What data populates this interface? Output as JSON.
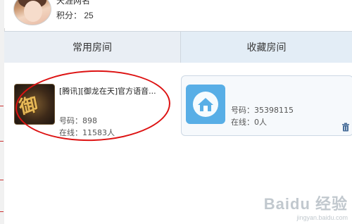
{
  "profile": {
    "username": "天涯网名",
    "points_label": "积分：",
    "points_value": "25"
  },
  "tabs": [
    {
      "label": "常用房间"
    },
    {
      "label": "收藏房间"
    }
  ],
  "rooms": [
    {
      "title": "[腾讯][御龙在天]官方语音...",
      "id_label": "号码：",
      "id_value": "898",
      "online_label": "在线：",
      "online_value": "11583人",
      "icon": "game-icon"
    },
    {
      "title": "",
      "id_label": "号码：",
      "id_value": "35398115",
      "online_label": "在线：",
      "online_value": "0人",
      "icon": "home-icon"
    }
  ],
  "watermark": {
    "logo": "Baidu 经验",
    "url": "jingyan.baidu.com"
  },
  "colors": {
    "highlight": "#dd1212",
    "tab_bg": "#e9eef4",
    "home_icon": "#58aee6"
  }
}
